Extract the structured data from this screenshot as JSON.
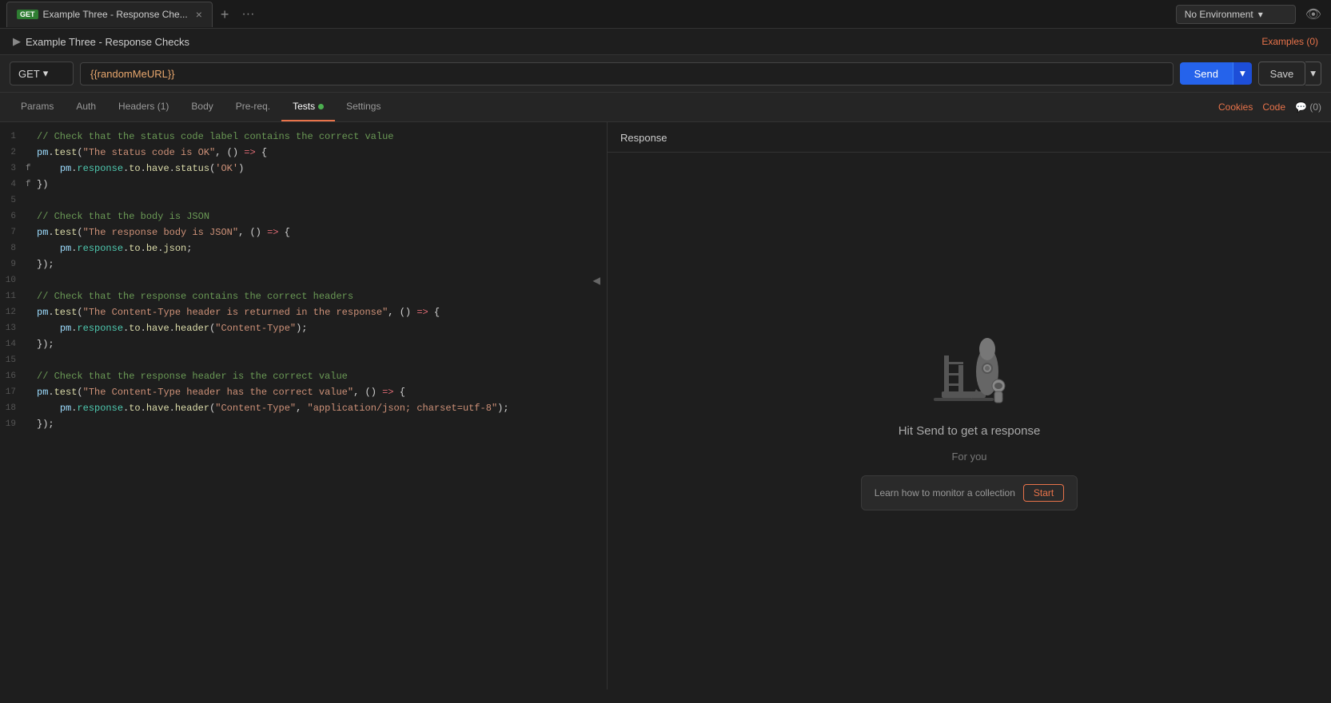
{
  "topBar": {
    "tab": {
      "method": "GET",
      "title": "Example Three - Response Che...",
      "closeLabel": "×"
    },
    "addTabLabel": "+",
    "moreLabel": "···",
    "env": {
      "label": "No Environment",
      "dropdownArrow": "▾"
    },
    "eyeLabel": "👁"
  },
  "titleRow": {
    "chevron": "▶",
    "title": "Example Three - Response Checks"
  },
  "requestRow": {
    "method": "GET",
    "methodArrow": "▾",
    "url": "{{randomMeURL}}",
    "sendLabel": "Send",
    "sendArrow": "▾",
    "saveLabel": "Save",
    "saveArrow": "▾",
    "examplesLabel": "Examples (0)"
  },
  "tabs": [
    {
      "id": "params",
      "label": "Params",
      "active": false
    },
    {
      "id": "auth",
      "label": "Auth",
      "active": false
    },
    {
      "id": "headers",
      "label": "Headers (1)",
      "active": false
    },
    {
      "id": "body",
      "label": "Body",
      "active": false
    },
    {
      "id": "prereq",
      "label": "Pre-req.",
      "active": false
    },
    {
      "id": "tests",
      "label": "Tests",
      "active": true,
      "dot": true
    },
    {
      "id": "settings",
      "label": "Settings",
      "active": false
    }
  ],
  "tabsRight": [
    {
      "id": "cookies",
      "label": "Cookies",
      "type": "link"
    },
    {
      "id": "code",
      "label": "Code",
      "type": "link"
    },
    {
      "id": "comments",
      "label": "(0)",
      "icon": "💬",
      "type": "plain"
    }
  ],
  "responseHeader": {
    "title": "Response"
  },
  "responsePanel": {
    "hitSendText": "Hit Send to get a response",
    "forYouText": "For you",
    "monitorText": "Learn how to monitor a collection",
    "startLabel": "Start"
  },
  "codeLines": [
    {
      "num": 1,
      "prefix": "",
      "tokens": [
        {
          "t": "comment",
          "v": "// Check that the status code label contains the correct value"
        }
      ]
    },
    {
      "num": 2,
      "prefix": "",
      "tokens": [
        {
          "t": "var",
          "v": "pm"
        },
        {
          "t": "plain",
          "v": "."
        },
        {
          "t": "func",
          "v": "test"
        },
        {
          "t": "plain",
          "v": "("
        },
        {
          "t": "string",
          "v": "\"The status code is OK\""
        },
        {
          "t": "plain",
          "v": ", () "
        },
        {
          "t": "arrow",
          "v": "=>"
        },
        {
          "t": "plain",
          "v": " {"
        }
      ]
    },
    {
      "num": 3,
      "prefix": "f",
      "tokens": [
        {
          "t": "plain",
          "v": "    "
        },
        {
          "t": "var",
          "v": "pm"
        },
        {
          "t": "plain",
          "v": "."
        },
        {
          "t": "obj",
          "v": "response"
        },
        {
          "t": "plain",
          "v": "."
        },
        {
          "t": "func",
          "v": "to"
        },
        {
          "t": "plain",
          "v": "."
        },
        {
          "t": "func",
          "v": "have"
        },
        {
          "t": "plain",
          "v": "."
        },
        {
          "t": "func",
          "v": "status"
        },
        {
          "t": "plain",
          "v": "("
        },
        {
          "t": "string",
          "v": "'OK'"
        },
        {
          "t": "plain",
          "v": ")"
        }
      ]
    },
    {
      "num": 4,
      "prefix": "f",
      "tokens": [
        {
          "t": "plain",
          "v": "})"
        }
      ]
    },
    {
      "num": 5,
      "prefix": "",
      "tokens": []
    },
    {
      "num": 6,
      "prefix": "",
      "tokens": [
        {
          "t": "comment",
          "v": "// Check that the body is JSON"
        }
      ]
    },
    {
      "num": 7,
      "prefix": "",
      "tokens": [
        {
          "t": "var",
          "v": "pm"
        },
        {
          "t": "plain",
          "v": "."
        },
        {
          "t": "func",
          "v": "test"
        },
        {
          "t": "plain",
          "v": "("
        },
        {
          "t": "string",
          "v": "\"The response body is JSON\""
        },
        {
          "t": "plain",
          "v": ", () "
        },
        {
          "t": "arrow",
          "v": "=>"
        },
        {
          "t": "plain",
          "v": " {"
        }
      ]
    },
    {
      "num": 8,
      "prefix": "",
      "tokens": [
        {
          "t": "plain",
          "v": "    "
        },
        {
          "t": "var",
          "v": "pm"
        },
        {
          "t": "plain",
          "v": "."
        },
        {
          "t": "obj",
          "v": "response"
        },
        {
          "t": "plain",
          "v": "."
        },
        {
          "t": "func",
          "v": "to"
        },
        {
          "t": "plain",
          "v": "."
        },
        {
          "t": "func",
          "v": "be"
        },
        {
          "t": "plain",
          "v": "."
        },
        {
          "t": "func",
          "v": "json"
        },
        {
          "t": "plain",
          "v": ";"
        }
      ]
    },
    {
      "num": 9,
      "prefix": "",
      "tokens": [
        {
          "t": "plain",
          "v": "});"
        }
      ]
    },
    {
      "num": 10,
      "prefix": "",
      "tokens": []
    },
    {
      "num": 11,
      "prefix": "",
      "tokens": [
        {
          "t": "comment",
          "v": "// Check that the response contains the correct headers"
        }
      ]
    },
    {
      "num": 12,
      "prefix": "",
      "tokens": [
        {
          "t": "var",
          "v": "pm"
        },
        {
          "t": "plain",
          "v": "."
        },
        {
          "t": "func",
          "v": "test"
        },
        {
          "t": "plain",
          "v": "("
        },
        {
          "t": "string",
          "v": "\"The Content-Type header is returned in the response\""
        },
        {
          "t": "plain",
          "v": ", () "
        },
        {
          "t": "arrow",
          "v": "=>"
        },
        {
          "t": "plain",
          "v": " {"
        }
      ]
    },
    {
      "num": 13,
      "prefix": "",
      "tokens": [
        {
          "t": "plain",
          "v": "    "
        },
        {
          "t": "var",
          "v": "pm"
        },
        {
          "t": "plain",
          "v": "."
        },
        {
          "t": "obj",
          "v": "response"
        },
        {
          "t": "plain",
          "v": "."
        },
        {
          "t": "func",
          "v": "to"
        },
        {
          "t": "plain",
          "v": "."
        },
        {
          "t": "func",
          "v": "have"
        },
        {
          "t": "plain",
          "v": "."
        },
        {
          "t": "func",
          "v": "header"
        },
        {
          "t": "plain",
          "v": "("
        },
        {
          "t": "string",
          "v": "\"Content-Type\""
        },
        {
          "t": "plain",
          "v": ");"
        }
      ]
    },
    {
      "num": 14,
      "prefix": "",
      "tokens": [
        {
          "t": "plain",
          "v": "});"
        }
      ]
    },
    {
      "num": 15,
      "prefix": "",
      "tokens": []
    },
    {
      "num": 16,
      "prefix": "",
      "tokens": [
        {
          "t": "comment",
          "v": "// Check that the response header is the correct value"
        }
      ]
    },
    {
      "num": 17,
      "prefix": "",
      "tokens": [
        {
          "t": "var",
          "v": "pm"
        },
        {
          "t": "plain",
          "v": "."
        },
        {
          "t": "func",
          "v": "test"
        },
        {
          "t": "plain",
          "v": "("
        },
        {
          "t": "string",
          "v": "\"The Content-Type header has the correct value\""
        },
        {
          "t": "plain",
          "v": ", () "
        },
        {
          "t": "arrow",
          "v": "=>"
        },
        {
          "t": "plain",
          "v": " {"
        }
      ]
    },
    {
      "num": 18,
      "prefix": "",
      "tokens": [
        {
          "t": "plain",
          "v": "    "
        },
        {
          "t": "var",
          "v": "pm"
        },
        {
          "t": "plain",
          "v": "."
        },
        {
          "t": "obj",
          "v": "response"
        },
        {
          "t": "plain",
          "v": "."
        },
        {
          "t": "func",
          "v": "to"
        },
        {
          "t": "plain",
          "v": "."
        },
        {
          "t": "func",
          "v": "have"
        },
        {
          "t": "plain",
          "v": "."
        },
        {
          "t": "func",
          "v": "header"
        },
        {
          "t": "plain",
          "v": "("
        },
        {
          "t": "string",
          "v": "\"Content-Type\""
        },
        {
          "t": "plain",
          "v": ", "
        },
        {
          "t": "string",
          "v": "\"application/json; charset=utf-8\""
        },
        {
          "t": "plain",
          "v": ");"
        }
      ]
    },
    {
      "num": 19,
      "prefix": "",
      "tokens": [
        {
          "t": "plain",
          "v": "});"
        }
      ]
    }
  ]
}
